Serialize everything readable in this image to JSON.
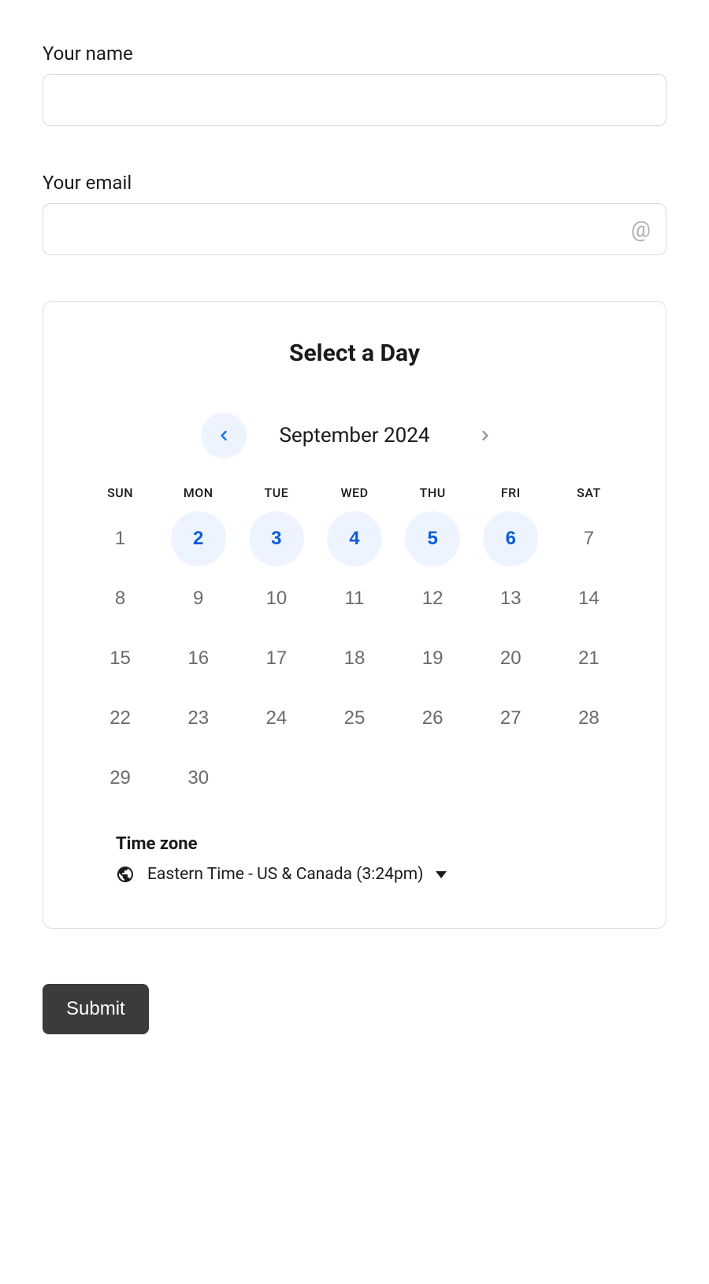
{
  "form": {
    "name_label": "Your name",
    "name_value": "",
    "email_label": "Your email",
    "email_value": "",
    "submit_label": "Submit"
  },
  "calendar": {
    "title": "Select a Day",
    "month_label": "September 2024",
    "weekdays": [
      "SUN",
      "MON",
      "TUE",
      "WED",
      "THU",
      "FRI",
      "SAT"
    ],
    "weeks": [
      [
        {
          "day": "1",
          "available": false
        },
        {
          "day": "2",
          "available": true
        },
        {
          "day": "3",
          "available": true
        },
        {
          "day": "4",
          "available": true
        },
        {
          "day": "5",
          "available": true
        },
        {
          "day": "6",
          "available": true
        },
        {
          "day": "7",
          "available": false
        }
      ],
      [
        {
          "day": "8",
          "available": false
        },
        {
          "day": "9",
          "available": false
        },
        {
          "day": "10",
          "available": false
        },
        {
          "day": "11",
          "available": false
        },
        {
          "day": "12",
          "available": false
        },
        {
          "day": "13",
          "available": false
        },
        {
          "day": "14",
          "available": false
        }
      ],
      [
        {
          "day": "15",
          "available": false
        },
        {
          "day": "16",
          "available": false
        },
        {
          "day": "17",
          "available": false
        },
        {
          "day": "18",
          "available": false
        },
        {
          "day": "19",
          "available": false
        },
        {
          "day": "20",
          "available": false
        },
        {
          "day": "21",
          "available": false
        }
      ],
      [
        {
          "day": "22",
          "available": false
        },
        {
          "day": "23",
          "available": false
        },
        {
          "day": "24",
          "available": false
        },
        {
          "day": "25",
          "available": false
        },
        {
          "day": "26",
          "available": false
        },
        {
          "day": "27",
          "available": false
        },
        {
          "day": "28",
          "available": false
        }
      ],
      [
        {
          "day": "29",
          "available": false
        },
        {
          "day": "30",
          "available": false
        },
        {
          "day": "",
          "available": false
        },
        {
          "day": "",
          "available": false
        },
        {
          "day": "",
          "available": false
        },
        {
          "day": "",
          "available": false
        },
        {
          "day": "",
          "available": false
        }
      ]
    ],
    "timezone": {
      "title": "Time zone",
      "value": "Eastern Time - US & Canada (3:24pm)"
    }
  }
}
